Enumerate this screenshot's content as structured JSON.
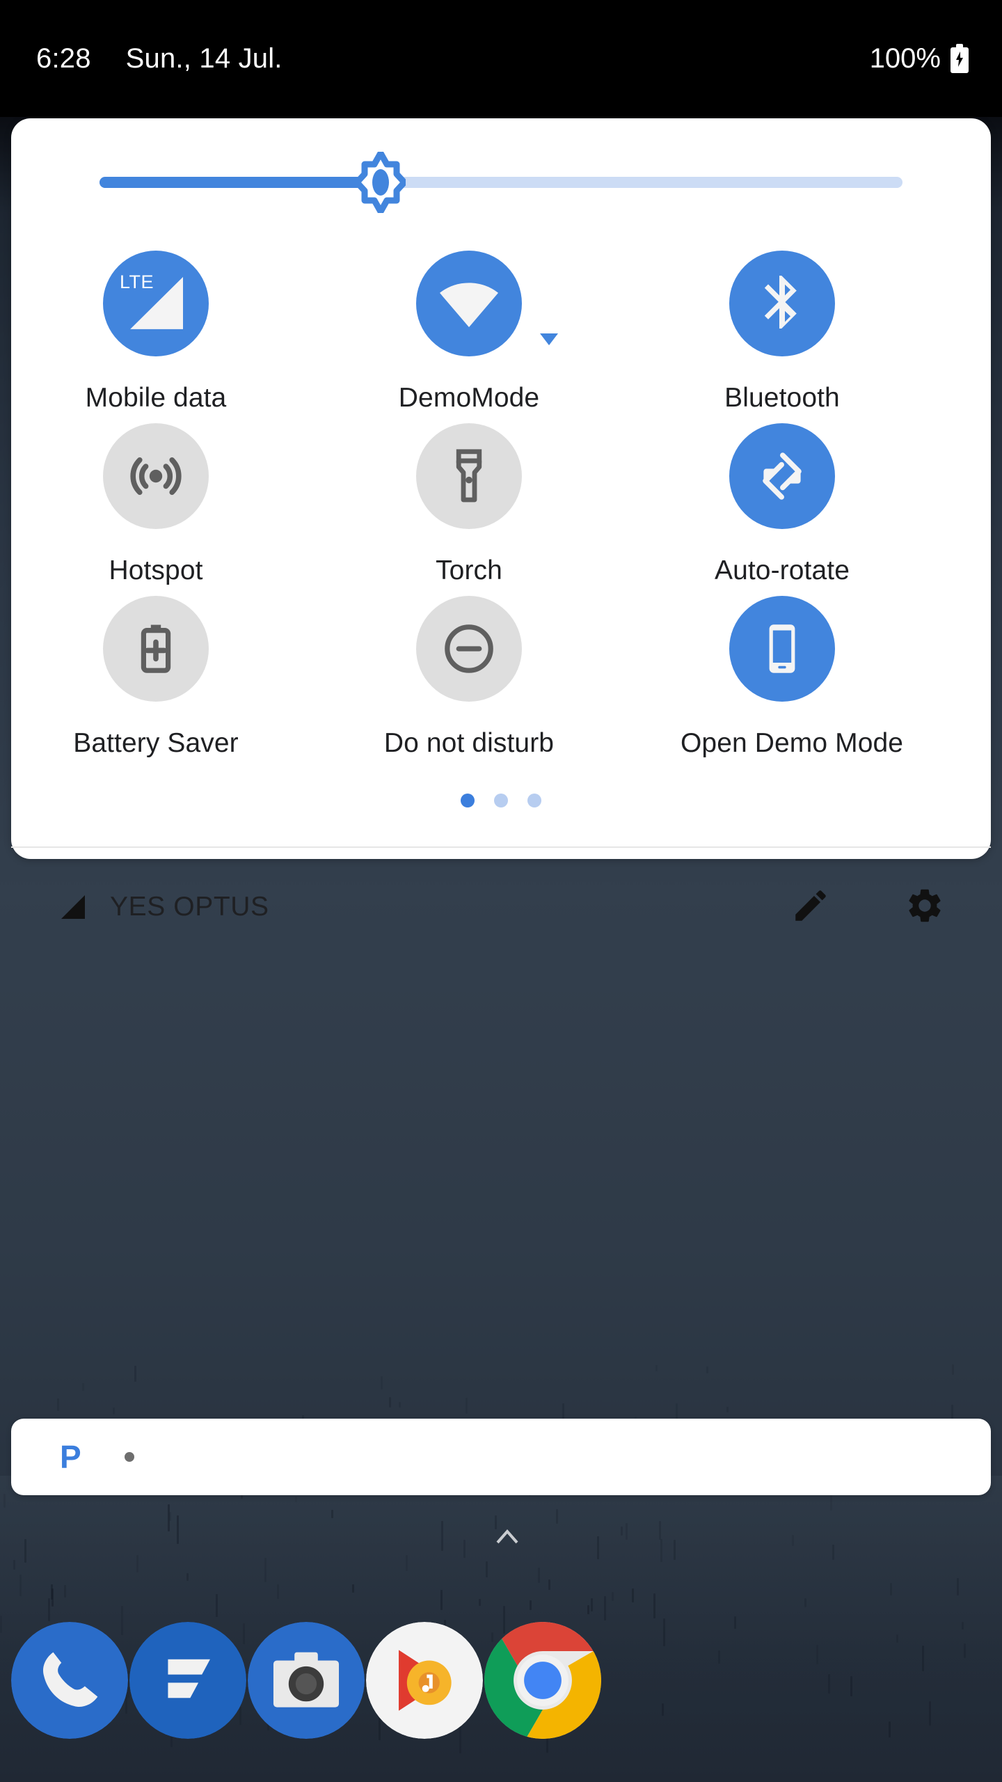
{
  "statusbar": {
    "time": "6:28",
    "date": "Sun., 14 Jul.",
    "battery_text": "100%",
    "battery_icon": "battery-charging-icon"
  },
  "quick_settings": {
    "brightness": {
      "name": "brightness-slider",
      "value_percent": 35,
      "thumb_icon": "brightness-sun-icon"
    },
    "tiles": [
      {
        "label": "Mobile data",
        "icon": "lte-signal-icon",
        "active": true,
        "badge": "LTE",
        "expandable": false
      },
      {
        "label": "DemoMode",
        "icon": "wifi-icon",
        "active": true,
        "badge": "",
        "expandable": true
      },
      {
        "label": "Bluetooth",
        "icon": "bluetooth-icon",
        "active": true,
        "badge": "",
        "expandable": false
      },
      {
        "label": "Hotspot",
        "icon": "hotspot-icon",
        "active": false,
        "badge": "",
        "expandable": false
      },
      {
        "label": "Torch",
        "icon": "flashlight-icon",
        "active": false,
        "badge": "",
        "expandable": false
      },
      {
        "label": "Auto-rotate",
        "icon": "auto-rotate-icon",
        "active": true,
        "badge": "",
        "expandable": false
      },
      {
        "label": "Battery Saver",
        "icon": "battery-saver-icon",
        "active": false,
        "badge": "",
        "expandable": false
      },
      {
        "label": "Do not disturb",
        "icon": "do-not-disturb-icon",
        "active": false,
        "badge": "",
        "expandable": false
      },
      {
        "label": "Open Demo Mode",
        "icon": "phone-device-icon",
        "active": true,
        "badge": "",
        "expandable": false
      }
    ],
    "pages": {
      "count": 3,
      "current": 1
    },
    "footer": {
      "carrier": "YES OPTUS",
      "carrier_icon": "signal-triangle-icon",
      "edit_icon": "pencil-edit-icon",
      "settings_icon": "gear-settings-icon"
    }
  },
  "notification": {
    "app_icon": "p-app-icon",
    "app_initial": "P",
    "separator": "dot-separator"
  },
  "home": {
    "home_indicator_icon": "chevron-up-icon",
    "dock": [
      {
        "label": "Phone",
        "icon": "phone-icon"
      },
      {
        "label": "Messages",
        "icon": "messages-icon"
      },
      {
        "label": "Camera",
        "icon": "camera-icon"
      },
      {
        "label": "Play Music",
        "icon": "play-music-icon"
      },
      {
        "label": "Chrome",
        "icon": "chrome-icon"
      }
    ]
  },
  "colors": {
    "accent": "#4285dd",
    "tile_off": "#dedede",
    "panel_bg": "#ffffff",
    "statusbar_bg": "#000000",
    "text": "#1f2023"
  }
}
